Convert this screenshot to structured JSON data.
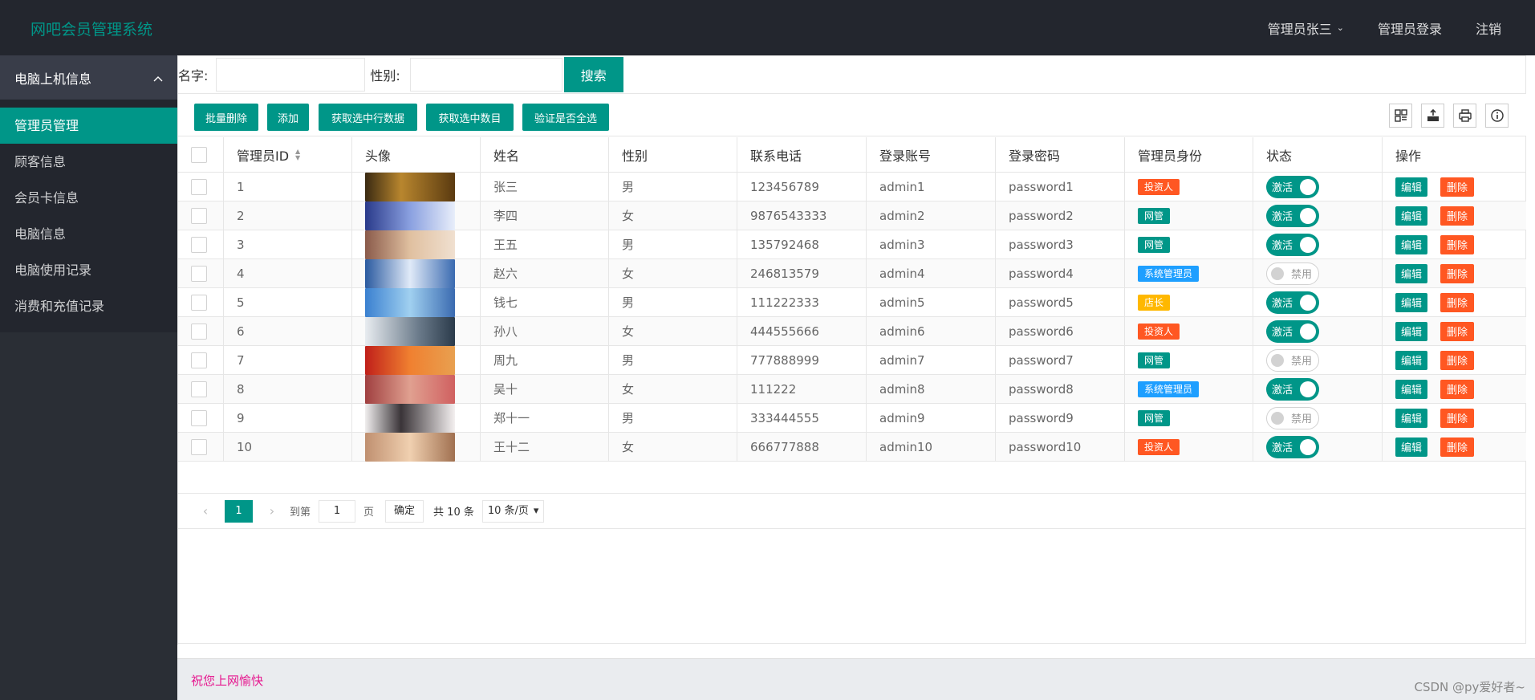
{
  "header": {
    "title": "网吧会员管理系统",
    "nav": [
      "管理员张三",
      "管理员登录",
      "注销"
    ]
  },
  "sidebar": {
    "group": "电脑上机信息",
    "items": [
      {
        "label": "管理员管理",
        "active": true
      },
      {
        "label": "顾客信息",
        "active": false
      },
      {
        "label": "会员卡信息",
        "active": false
      },
      {
        "label": "电脑信息",
        "active": false
      },
      {
        "label": "电脑使用记录",
        "active": false
      },
      {
        "label": "消费和充值记录",
        "active": false
      }
    ]
  },
  "search": {
    "name_label": "名字:",
    "gender_label": "性别:",
    "button": "搜索"
  },
  "toolbar": {
    "buttons": [
      "批量删除",
      "添加",
      "获取选中行数据",
      "获取选中数目",
      "验证是否全选"
    ],
    "icons": [
      "filter-columns-icon",
      "export-icon",
      "print-icon",
      "info-icon"
    ]
  },
  "table": {
    "columns": [
      "管理员ID",
      "头像",
      "姓名",
      "性别",
      "联系电话",
      "登录账号",
      "登录密码",
      "管理员身份",
      "状态",
      "操作"
    ],
    "rows": [
      {
        "id": "1",
        "name": "张三",
        "gender": "男",
        "phone": "123456789",
        "account": "admin1",
        "password": "password1",
        "role": "投资人",
        "status": "激活",
        "active": true
      },
      {
        "id": "2",
        "name": "李四",
        "gender": "女",
        "phone": "9876543333",
        "account": "admin2",
        "password": "password2",
        "role": "网管",
        "status": "激活",
        "active": true
      },
      {
        "id": "3",
        "name": "王五",
        "gender": "男",
        "phone": "135792468",
        "account": "admin3",
        "password": "password3",
        "role": "网管",
        "status": "激活",
        "active": true
      },
      {
        "id": "4",
        "name": "赵六",
        "gender": "女",
        "phone": "246813579",
        "account": "admin4",
        "password": "password4",
        "role": "系统管理员",
        "status": "禁用",
        "active": false
      },
      {
        "id": "5",
        "name": "钱七",
        "gender": "男",
        "phone": "111222333",
        "account": "admin5",
        "password": "password5",
        "role": "店长",
        "status": "激活",
        "active": true
      },
      {
        "id": "6",
        "name": "孙八",
        "gender": "女",
        "phone": "444555666",
        "account": "admin6",
        "password": "password6",
        "role": "投资人",
        "status": "激活",
        "active": true
      },
      {
        "id": "7",
        "name": "周九",
        "gender": "男",
        "phone": "777888999",
        "account": "admin7",
        "password": "password7",
        "role": "网管",
        "status": "禁用",
        "active": false
      },
      {
        "id": "8",
        "name": "吴十",
        "gender": "女",
        "phone": "111222",
        "account": "admin8",
        "password": "password8",
        "role": "系统管理员",
        "status": "激活",
        "active": true
      },
      {
        "id": "9",
        "name": "郑十一",
        "gender": "男",
        "phone": "333444555",
        "account": "admin9",
        "password": "password9",
        "role": "网管",
        "status": "禁用",
        "active": false
      },
      {
        "id": "10",
        "name": "王十二",
        "gender": "女",
        "phone": "666777888",
        "account": "admin10",
        "password": "password10",
        "role": "投资人",
        "status": "激活",
        "active": true
      }
    ],
    "edit_label": "编辑",
    "delete_label": "删除"
  },
  "role_colors": {
    "投资人": "#FF5722",
    "网管": "#009688",
    "系统管理员": "#1E9FFF",
    "店长": "#FFB800"
  },
  "pager": {
    "current": "1",
    "goto_label": "到第",
    "goto_value": "1",
    "page_label": "页",
    "confirm": "确定",
    "total": "共 10 条",
    "per_page": "10 条/页"
  },
  "footer": {
    "text": "祝您上网愉快",
    "watermark": "CSDN @py爱好者~"
  }
}
